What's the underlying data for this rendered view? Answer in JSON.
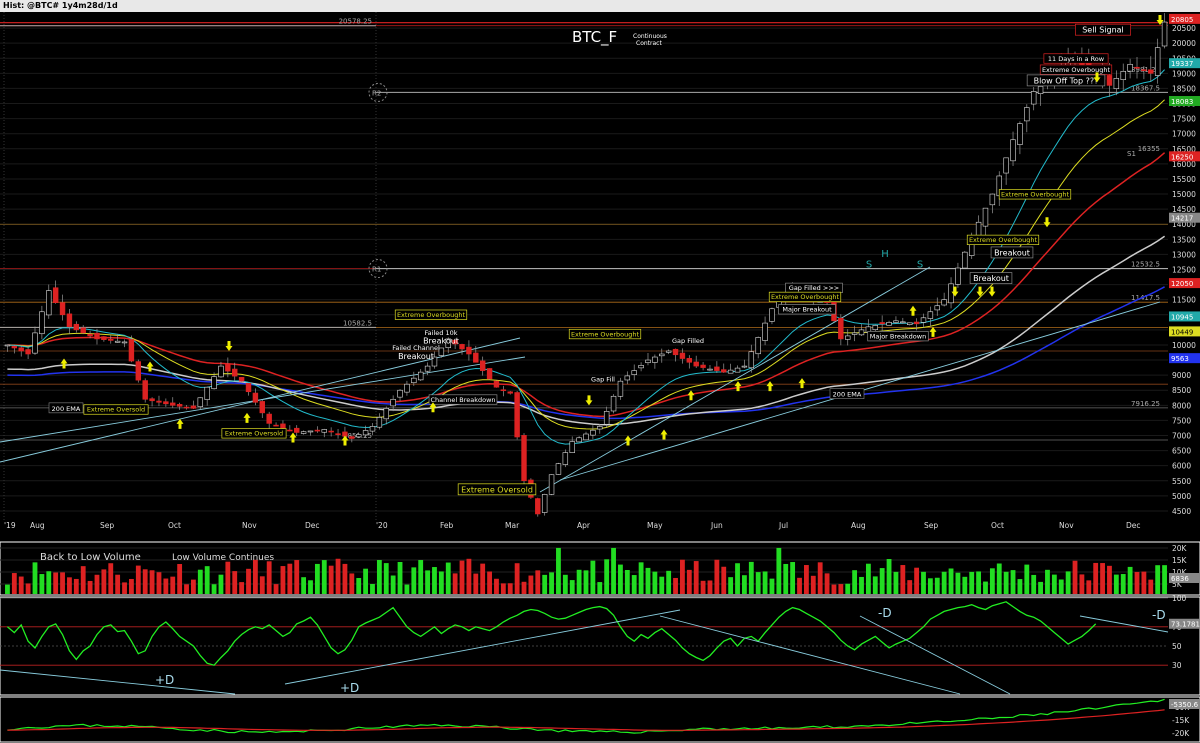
{
  "window": {
    "title": "Hist: @BTC# 1y4m28d/1d"
  },
  "header": {
    "symbol": "BTC_F",
    "subtitle_line1": "Continuous",
    "subtitle_line2": "Contract"
  },
  "colors": {
    "up": "#22dd22",
    "down": "#dd2222",
    "ema200": "#cccccc",
    "ema_red": "#dd2222",
    "ema_blue": "#2233ee",
    "ema_yellow": "#dddd22",
    "ema_cyan": "#22bbcc",
    "rsi": "#22ee22",
    "trend_line": "#88ccdd"
  },
  "chart_data": [
    {
      "type": "candlestick",
      "panel": "price",
      "x_labels": [
        "'19",
        "Aug",
        "Sep",
        "Oct",
        "Nov",
        "Dec",
        "'20",
        "Feb",
        "Mar",
        "Apr",
        "May",
        "Jun",
        "Jul",
        "Aug",
        "Sep",
        "Oct",
        "Nov",
        "Dec"
      ],
      "y_ticks": [
        4500,
        5000,
        5500,
        6000,
        6500,
        7000,
        7500,
        8000,
        8500,
        9000,
        9500,
        10000,
        10500,
        11000,
        11500,
        12000,
        12500,
        13000,
        13500,
        14000,
        14500,
        15000,
        15500,
        16000,
        16500,
        17000,
        17500,
        18000,
        18500,
        19000,
        19500,
        20000,
        20500
      ],
      "ylim": [
        4200,
        20900
      ],
      "close_path": [
        [
          0,
          10000
        ],
        [
          3,
          9700
        ],
        [
          6,
          11800
        ],
        [
          9,
          10600
        ],
        [
          13,
          10200
        ],
        [
          17,
          10100
        ],
        [
          20,
          8200
        ],
        [
          24,
          8000
        ],
        [
          27,
          7900
        ],
        [
          31,
          9300
        ],
        [
          34,
          8800
        ],
        [
          38,
          7400
        ],
        [
          42,
          7100
        ],
        [
          46,
          7200
        ],
        [
          50,
          6900
        ],
        [
          53,
          7300
        ],
        [
          57,
          8500
        ],
        [
          61,
          9300
        ],
        [
          64,
          10200
        ],
        [
          67,
          9700
        ],
        [
          71,
          8600
        ],
        [
          73,
          8400
        ],
        [
          75,
          5500
        ],
        [
          77,
          4400
        ],
        [
          79,
          5700
        ],
        [
          82,
          6800
        ],
        [
          86,
          7300
        ],
        [
          89,
          8800
        ],
        [
          93,
          9500
        ],
        [
          96,
          9800
        ],
        [
          100,
          9300
        ],
        [
          104,
          9100
        ],
        [
          107,
          9300
        ],
        [
          111,
          11200
        ],
        [
          114,
          11900
        ],
        [
          117,
          11500
        ],
        [
          119,
          11400
        ],
        [
          121,
          10200
        ],
        [
          125,
          10600
        ],
        [
          129,
          10800
        ],
        [
          132,
          10700
        ],
        [
          136,
          11500
        ],
        [
          140,
          13600
        ],
        [
          143,
          15000
        ],
        [
          146,
          16800
        ],
        [
          149,
          18400
        ],
        [
          152,
          18900
        ],
        [
          154,
          19500
        ],
        [
          157,
          19200
        ],
        [
          160,
          18600
        ],
        [
          163,
          19300
        ],
        [
          166,
          19000
        ],
        [
          168,
          20700
        ]
      ],
      "reference_values": [
        20578.25,
        12532.5,
        11417.5,
        10582.5,
        7916.25,
        6851.25,
        16355,
        18981.25,
        18367.5
      ],
      "pivot_labels": [
        "R2",
        "R1",
        "S1"
      ],
      "axis_badges": [
        "20805",
        "19337",
        "18083",
        "16250",
        "14217",
        "12050",
        "10945",
        "10449",
        "9563"
      ],
      "ema_labels": [
        "200 EMA",
        "200 EMA"
      ],
      "annotations": [
        "Sell Signal",
        "11 Days in a Row",
        "Extreme Overbought",
        "Blow Off Top ???",
        "Extreme Overbought",
        "Extreme Overbought",
        "Breakout",
        "Breakout",
        "Gap Filled >>>",
        "Extreme Overbought",
        "Major Breakout",
        "Major Breakdown",
        "Gap Filled",
        "Extreme Overbought",
        "Gap Fill",
        "Extreme Overbought",
        "Failed 10k",
        "Breakout",
        "Failed Channel",
        "Breakout",
        "Channel Breakdown",
        "Extreme Oversold",
        "Extreme Oversold",
        "Extreme Oversold",
        "H",
        "S",
        "S"
      ]
    },
    {
      "type": "bar",
      "panel": "volume",
      "title": "Back to Low Volume",
      "subtitle": "Low Volume Continues",
      "y_ticks": [
        "20K",
        "15K",
        "10K",
        "5K"
      ],
      "ylim": [
        0,
        20000
      ],
      "axis_badge": "6836"
    },
    {
      "type": "line",
      "panel": "rsi",
      "y_ticks": [
        30,
        50,
        70,
        100
      ],
      "ylim": [
        0,
        100
      ],
      "axis_badge": "73.1781",
      "labels": [
        "+D",
        "+D",
        "-D",
        "-D"
      ],
      "values": [
        70,
        64,
        72,
        55,
        48,
        60,
        70,
        73,
        62,
        45,
        36,
        45,
        50,
        62,
        70,
        72,
        65,
        66,
        55,
        42,
        45,
        60,
        70,
        75,
        68,
        60,
        55,
        50,
        40,
        32,
        30,
        38,
        45,
        55,
        62,
        67,
        70,
        68,
        72,
        66,
        60,
        64,
        73,
        76,
        80,
        72,
        60,
        48,
        42,
        46,
        56,
        70,
        74,
        77,
        80,
        85,
        90,
        80,
        70,
        64,
        60,
        65,
        70,
        63,
        68,
        72,
        70,
        66,
        70,
        68,
        66,
        70,
        75,
        79,
        82,
        86,
        88,
        87,
        84,
        80,
        78,
        79,
        82,
        85,
        88,
        90,
        91,
        89,
        82,
        70,
        60,
        55,
        62,
        58,
        64,
        68,
        62,
        56,
        48,
        42,
        38,
        35,
        40,
        48,
        55,
        58,
        50,
        58,
        60,
        55,
        64,
        72,
        80,
        86,
        90,
        88,
        84,
        80,
        76,
        70,
        64,
        56,
        50,
        46,
        52,
        56,
        60,
        54,
        48,
        52,
        55,
        58,
        64,
        70,
        78,
        82,
        86,
        88,
        90,
        91,
        93,
        90,
        88,
        92,
        94,
        96,
        91,
        86,
        82,
        80,
        76,
        70,
        64,
        58,
        52,
        56,
        60,
        66,
        73
      ]
    },
    {
      "type": "line",
      "panel": "oscillator",
      "y_ticks": [
        "-10K",
        "-15K",
        "-20K"
      ],
      "ylim": [
        -25000,
        -5000
      ],
      "axis_badge": "-5350.6"
    }
  ]
}
